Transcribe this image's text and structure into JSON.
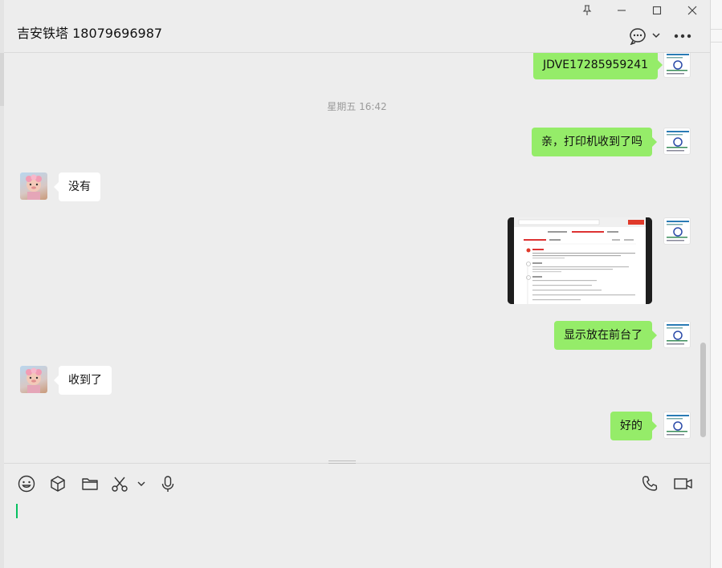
{
  "header": {
    "title": "吉安铁塔 18079696987"
  },
  "messages": {
    "m1": {
      "text": "JDVE17285959241"
    },
    "timestamp": "星期五 16:42",
    "m2": {
      "text": "亲，打印机收到了吗"
    },
    "m3": {
      "text": "没有"
    },
    "m5": {
      "text": "显示放在前台了"
    },
    "m6": {
      "text": "收到了"
    },
    "m7": {
      "text": "好的"
    }
  },
  "icons": {
    "pin": "pin-icon",
    "minimize": "minimize-icon",
    "maximize": "maximize-icon",
    "close": "close-icon",
    "chat_info": "chat-bubble-icon",
    "more": "more-icon",
    "emoji": "emoji-icon",
    "favorites": "cube-icon",
    "file": "folder-icon",
    "screenshot": "scissors-icon",
    "voice_input": "microphone-icon",
    "voice_call": "phone-icon",
    "video_call": "video-icon"
  },
  "colors": {
    "my_bubble": "#95ec69",
    "their_bubble": "#ffffff",
    "background": "#ededed",
    "caret": "#07c160"
  }
}
